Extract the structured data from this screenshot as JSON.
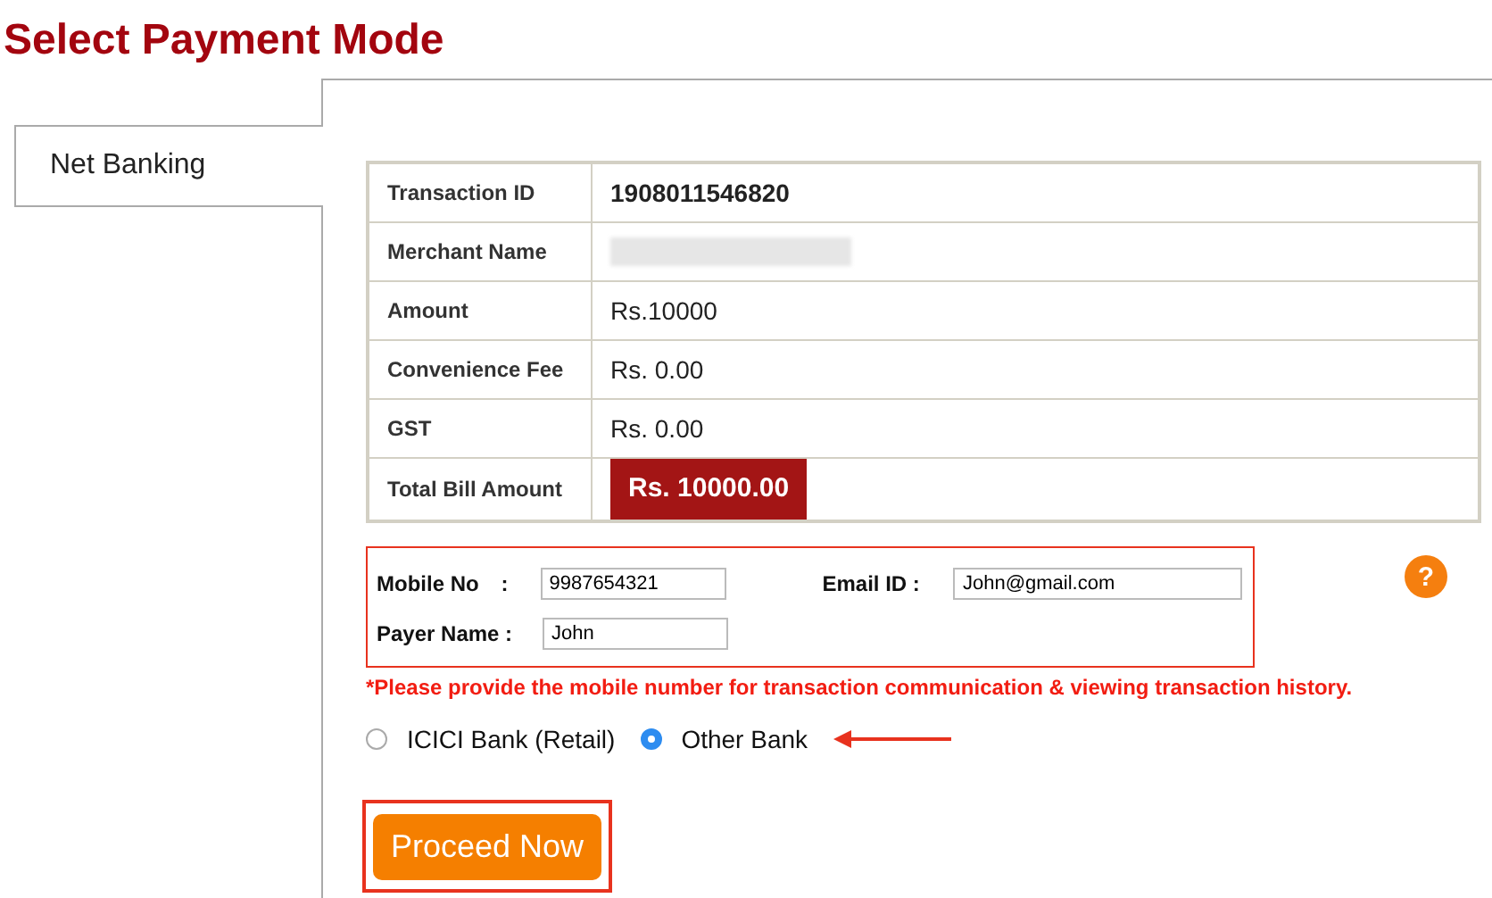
{
  "title": "Select Payment Mode",
  "tabs": [
    {
      "label": "Net Banking",
      "selected": true
    }
  ],
  "details": [
    {
      "label": "Transaction ID",
      "kind": "bold",
      "value": "1908011546820"
    },
    {
      "label": "Merchant Name",
      "kind": "blurred"
    },
    {
      "label": "Amount",
      "kind": "plain",
      "value": "Rs.10000"
    },
    {
      "label": "Convenience Fee",
      "kind": "plain",
      "value": "Rs. 0.00"
    },
    {
      "label": "GST",
      "kind": "plain",
      "value": "Rs. 0.00"
    },
    {
      "label": "Total Bill Amount",
      "kind": "total",
      "value": "Rs. 10000.00"
    }
  ],
  "form": {
    "mobile_label": "Mobile No",
    "mobile_colon": ":",
    "mobile": "9987654321",
    "email_label": "Email ID :",
    "email": "John@gmail.com",
    "payer_label": "Payer Name :",
    "payer": "John"
  },
  "help": "?",
  "note": "*Please provide the mobile number for transaction communication & viewing transaction history.",
  "banks": [
    {
      "label": "ICICI Bank (Retail)",
      "selected": false
    },
    {
      "label": "Other Bank",
      "selected": true
    }
  ],
  "button": "Proceed Now"
}
